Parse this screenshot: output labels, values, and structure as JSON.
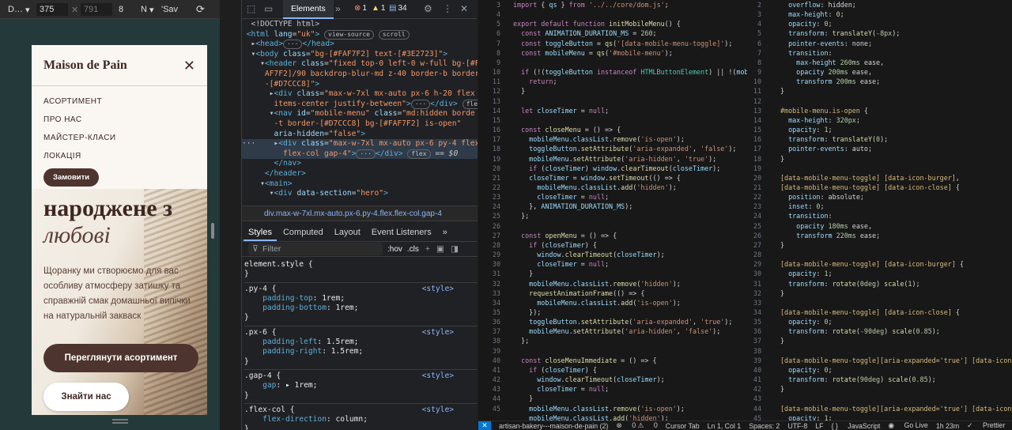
{
  "device_toolbar": {
    "device": "D…",
    "width": "375",
    "height": "791",
    "zoom": "8",
    "throttle": "N",
    "save": "'Sav"
  },
  "preview": {
    "brand": "Maison de Pain",
    "nav": [
      "АСОРТИМЕНТ",
      "ПРО НАС",
      "МАЙСТЕР-КЛАСИ",
      "ЛОКАЦІЯ"
    ],
    "order_button": "Замовити",
    "hero_title_1": "народжене з",
    "hero_title_2": "любові",
    "hero_desc": "Щоранку ми створюємо для вас особливу атмосферу затишку та справжній смак домашньої випічки на натуральній закваск",
    "cta_primary": "Переглянути асортимент",
    "cta_secondary": "Знайти нас"
  },
  "devtools": {
    "elements_tab": "Elements",
    "errors": "1",
    "warnings": "1",
    "info": "34",
    "breadcrumb": "div.max-w-7xl.mx-auto.px-6.py-4.flex.flex-col.gap-4",
    "style_tabs": [
      "Styles",
      "Computed",
      "Layout",
      "Event Listeners"
    ],
    "filter_placeholder": "Filter",
    "hov": ":hov",
    "cls": ".cls"
  },
  "editor_status": {
    "file": "artisan-bakery---maison-de-pain (2)",
    "problems": "0",
    "warnings": "0",
    "cursor_tab": "Cursor Tab",
    "position": "Ln 1, Col 1",
    "spaces": "Spaces: 2",
    "encoding": "UTF-8",
    "eol": "LF",
    "language": "JavaScript",
    "golive": "Go Live",
    "time": "1h 23m",
    "prettier": "Prettier"
  }
}
